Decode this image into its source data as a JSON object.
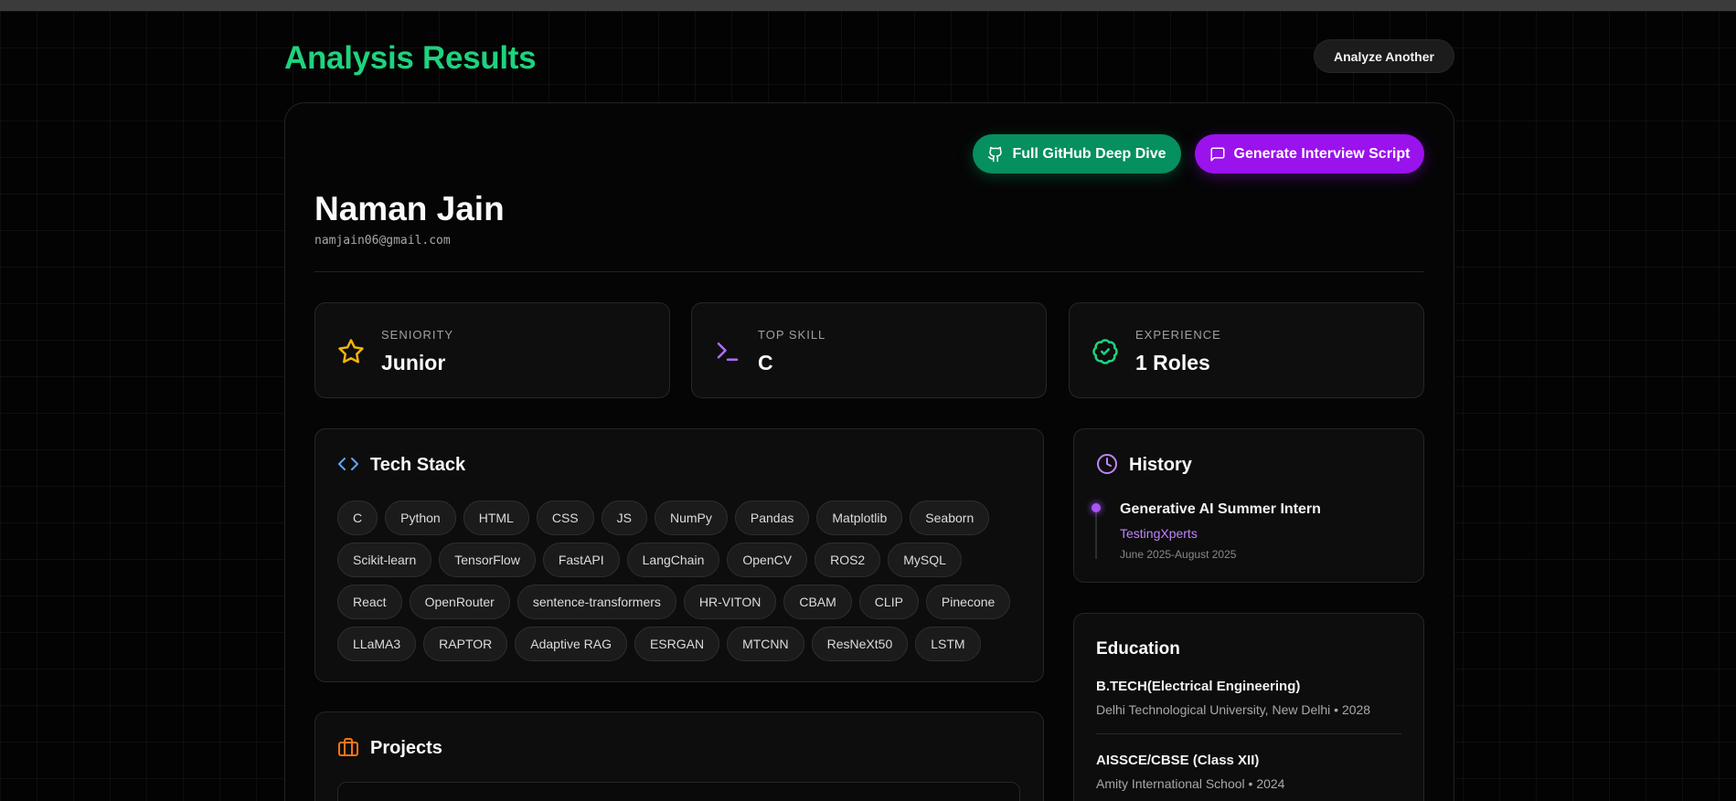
{
  "header": {
    "title": "Analysis Results",
    "analyze_another_label": "Analyze Another"
  },
  "actions": {
    "github_label": "Full GitHub Deep Dive",
    "interview_label": "Generate Interview Script"
  },
  "candidate": {
    "name": "Naman Jain",
    "email": "namjain06@gmail.com"
  },
  "stats": [
    {
      "label": "Seniority",
      "value": "Junior",
      "icon": "star-icon",
      "color": "#f5b40b"
    },
    {
      "label": "Top Skill",
      "value": "C",
      "icon": "terminal-icon",
      "color": "#b06ef5"
    },
    {
      "label": "Experience",
      "value": "1 Roles",
      "icon": "badge-check-icon",
      "color": "#1ed37e"
    }
  ],
  "tech_stack": {
    "title": "Tech Stack",
    "skills": [
      "C",
      "Python",
      "HTML",
      "CSS",
      "JS",
      "NumPy",
      "Pandas",
      "Matplotlib",
      "Seaborn",
      "Scikit-learn",
      "TensorFlow",
      "FastAPI",
      "LangChain",
      "OpenCV",
      "ROS2",
      "MySQL",
      "React",
      "OpenRouter",
      "sentence-transformers",
      "HR-VITON",
      "CBAM",
      "CLIP",
      "Pinecone",
      "LLaMA3",
      "RAPTOR",
      "Adaptive RAG",
      "ESRGAN",
      "MTCNN",
      "ResNeXt50",
      "LSTM"
    ]
  },
  "history": {
    "title": "History",
    "items": [
      {
        "role": "Generative AI Summer Intern",
        "company": "TestingXperts",
        "dates": "June 2025-August 2025"
      }
    ]
  },
  "education": {
    "title": "Education",
    "items": [
      {
        "degree": "B.TECH(Electrical Engineering)",
        "school": "Delhi Technological University, New Delhi • 2028"
      },
      {
        "degree": "AISSCE/CBSE (Class XII)",
        "school": "Amity International School • 2024"
      }
    ]
  },
  "projects": {
    "title": "Projects"
  },
  "colors": {
    "accent_green": "#1ed37e",
    "github_button": "#068f5f",
    "interview_button": "#9a12ec",
    "history_accent": "#a855f7"
  }
}
